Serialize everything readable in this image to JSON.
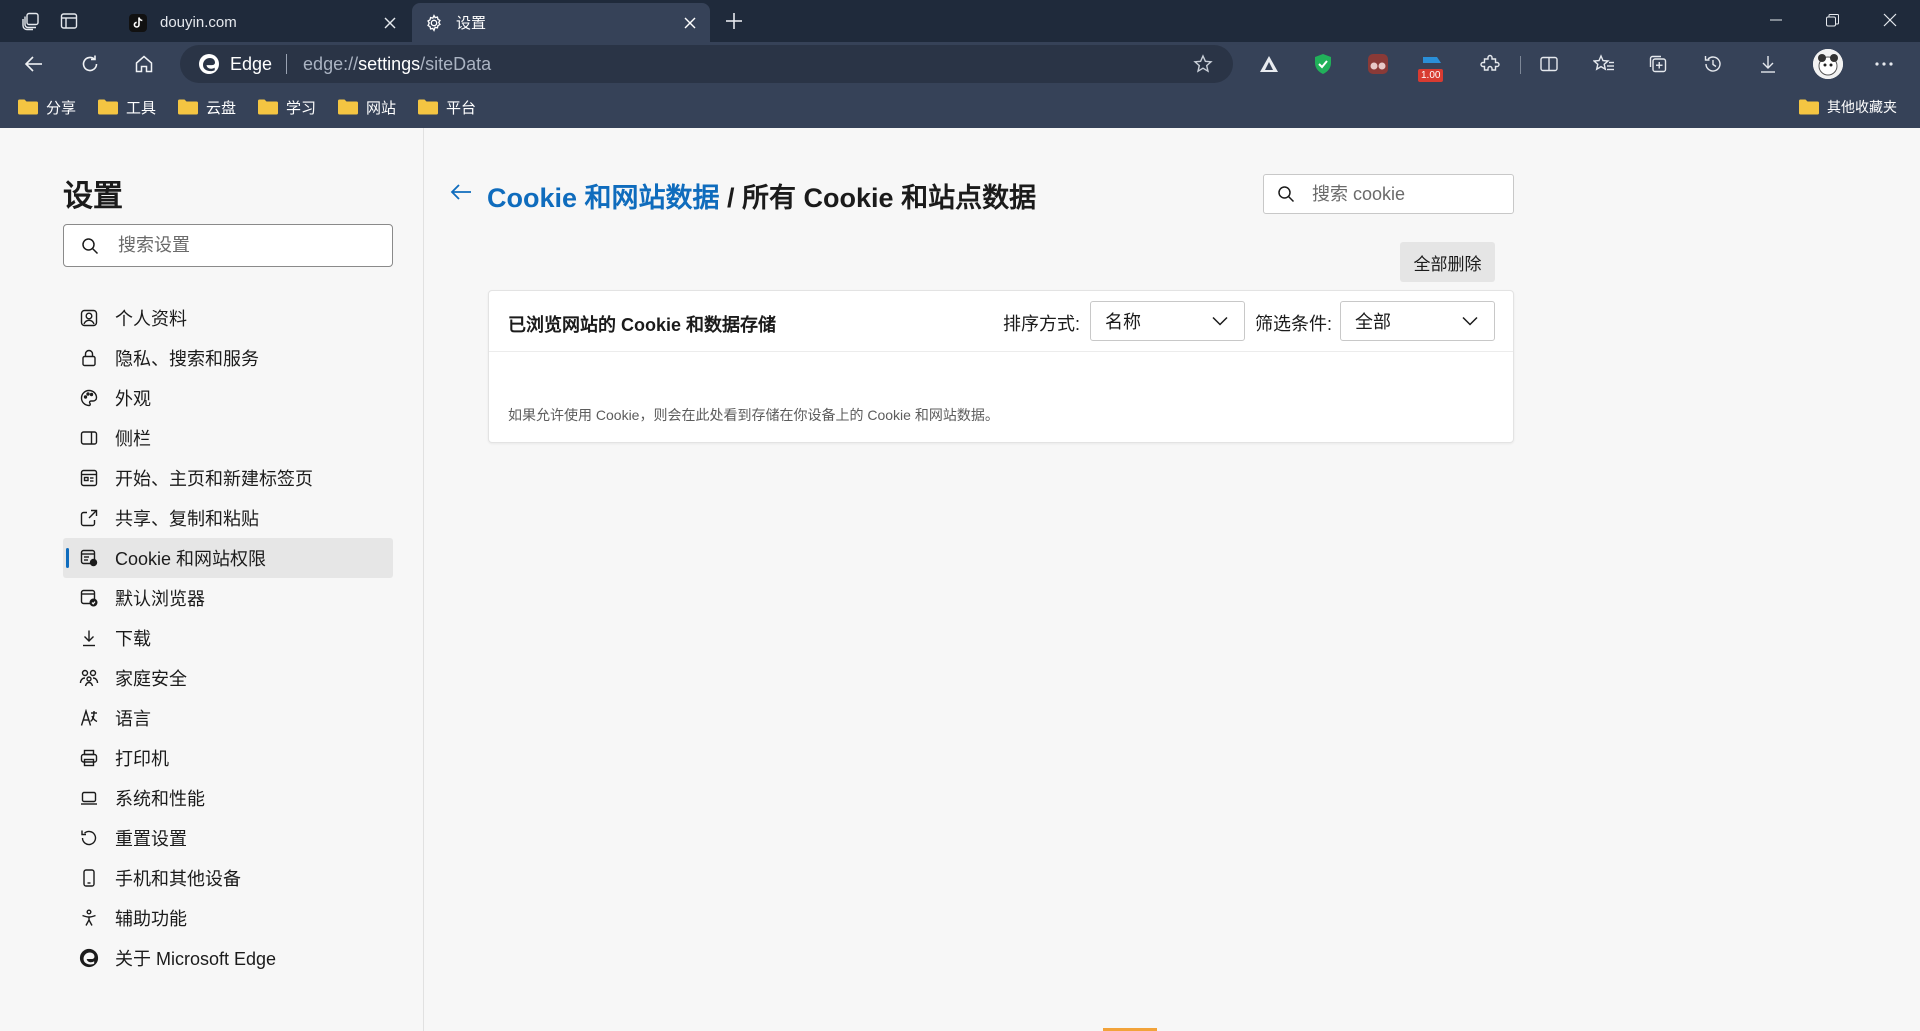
{
  "browser": {
    "tabs": [
      {
        "label": "douyin.com",
        "active": false,
        "favicon": "tiktok-icon"
      },
      {
        "label": "设置",
        "active": true,
        "favicon": "gear-icon"
      }
    ],
    "omnibox": {
      "brand": "Edge",
      "url_prefix": "edge://",
      "url_host": "settings",
      "url_path": "/siteData"
    },
    "extension_badge": "1.00",
    "favorites": [
      {
        "label": "分享"
      },
      {
        "label": "工具"
      },
      {
        "label": "云盘"
      },
      {
        "label": "学习"
      },
      {
        "label": "网站"
      },
      {
        "label": "平台"
      }
    ],
    "other_favorites": "其他收藏夹"
  },
  "sidebar": {
    "title": "设置",
    "search_placeholder": "搜索设置",
    "items": [
      {
        "label": "个人资料",
        "icon": "profile-icon"
      },
      {
        "label": "隐私、搜索和服务",
        "icon": "lock-icon"
      },
      {
        "label": "外观",
        "icon": "palette-icon"
      },
      {
        "label": "侧栏",
        "icon": "sidebar-icon"
      },
      {
        "label": "开始、主页和新建标签页",
        "icon": "home-page-icon"
      },
      {
        "label": "共享、复制和粘贴",
        "icon": "share-icon"
      },
      {
        "label": "Cookie 和网站权限",
        "icon": "cookie-site-icon",
        "selected": true
      },
      {
        "label": "默认浏览器",
        "icon": "default-browser-icon"
      },
      {
        "label": "下载",
        "icon": "download-icon"
      },
      {
        "label": "家庭安全",
        "icon": "family-icon"
      },
      {
        "label": "语言",
        "icon": "language-icon"
      },
      {
        "label": "打印机",
        "icon": "printer-icon"
      },
      {
        "label": "系统和性能",
        "icon": "laptop-icon"
      },
      {
        "label": "重置设置",
        "icon": "reset-icon"
      },
      {
        "label": "手机和其他设备",
        "icon": "phone-icon"
      },
      {
        "label": "辅助功能",
        "icon": "accessibility-icon"
      },
      {
        "label": "关于 Microsoft Edge",
        "icon": "edge-icon"
      }
    ]
  },
  "main": {
    "breadcrumb_link": "Cookie 和网站数据",
    "breadcrumb_sep": " / ",
    "breadcrumb_current": "所有 Cookie 和站点数据",
    "search_placeholder": "搜索 cookie",
    "delete_all": "全部删除",
    "card": {
      "title": "已浏览网站的 Cookie 和数据存储",
      "sort_label": "排序方式:",
      "sort_value": "名称",
      "filter_label": "筛选条件:",
      "filter_value": "全部",
      "empty_message": "如果允许使用 Cookie，则会在此处看到存储在你设备上的 Cookie 和网站数据。"
    }
  },
  "colors": {
    "accent": "#0f6cbd",
    "titlebar": "#1f2a3b",
    "toolbar": "#364258"
  }
}
